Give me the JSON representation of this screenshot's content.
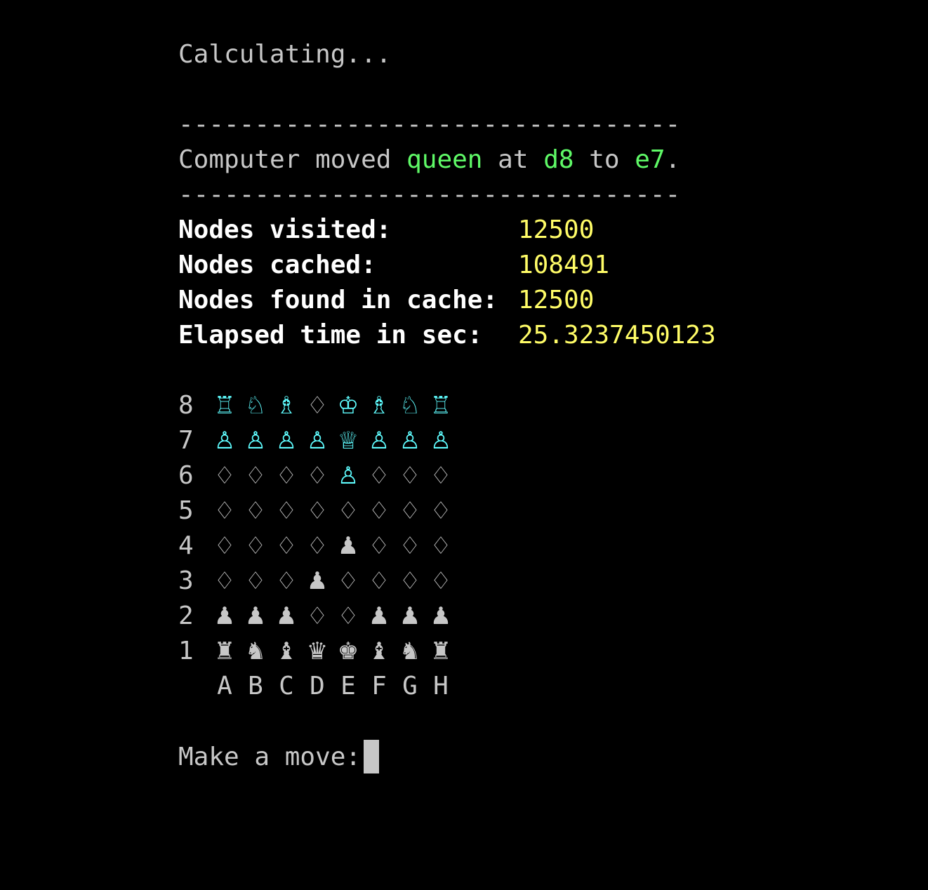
{
  "colors": {
    "background": "#000000",
    "text": "#c7c7c7",
    "bold_text": "#ffffff",
    "highlight_green": "#5ff967",
    "value_yellow": "#fffc67",
    "black_piece": "#5ffdff",
    "white_piece": "#c7c7c7"
  },
  "status": "Calculating...",
  "separator": "---------------------------------",
  "move_message": {
    "prefix": "Computer moved ",
    "piece": "queen",
    "at": " at ",
    "from": "d8",
    "to_word": " to ",
    "to": "e7",
    "suffix": "."
  },
  "stats": [
    {
      "label": "Nodes visited:",
      "value": "12500"
    },
    {
      "label": "Nodes cached:",
      "value": "108491"
    },
    {
      "label": "Nodes found in cache:",
      "value": "12500"
    },
    {
      "label": "Elapsed time in sec:",
      "value": "25.3237450123"
    }
  ],
  "board": {
    "ranks": [
      {
        "label": "8",
        "squares": [
          {
            "glyph": "♖",
            "side": "black"
          },
          {
            "glyph": "♘",
            "side": "black"
          },
          {
            "glyph": "♗",
            "side": "black"
          },
          {
            "glyph": "♢",
            "side": "empty"
          },
          {
            "glyph": "♔",
            "side": "black"
          },
          {
            "glyph": "♗",
            "side": "black"
          },
          {
            "glyph": "♘",
            "side": "black"
          },
          {
            "glyph": "♖",
            "side": "black"
          }
        ]
      },
      {
        "label": "7",
        "squares": [
          {
            "glyph": "♙",
            "side": "black"
          },
          {
            "glyph": "♙",
            "side": "black"
          },
          {
            "glyph": "♙",
            "side": "black"
          },
          {
            "glyph": "♙",
            "side": "black"
          },
          {
            "glyph": "♕",
            "side": "black"
          },
          {
            "glyph": "♙",
            "side": "black"
          },
          {
            "glyph": "♙",
            "side": "black"
          },
          {
            "glyph": "♙",
            "side": "black"
          }
        ]
      },
      {
        "label": "6",
        "squares": [
          {
            "glyph": "♢",
            "side": "empty"
          },
          {
            "glyph": "♢",
            "side": "empty"
          },
          {
            "glyph": "♢",
            "side": "empty"
          },
          {
            "glyph": "♢",
            "side": "empty"
          },
          {
            "glyph": "♙",
            "side": "black"
          },
          {
            "glyph": "♢",
            "side": "empty"
          },
          {
            "glyph": "♢",
            "side": "empty"
          },
          {
            "glyph": "♢",
            "side": "empty"
          }
        ]
      },
      {
        "label": "5",
        "squares": [
          {
            "glyph": "♢",
            "side": "empty"
          },
          {
            "glyph": "♢",
            "side": "empty"
          },
          {
            "glyph": "♢",
            "side": "empty"
          },
          {
            "glyph": "♢",
            "side": "empty"
          },
          {
            "glyph": "♢",
            "side": "empty"
          },
          {
            "glyph": "♢",
            "side": "empty"
          },
          {
            "glyph": "♢",
            "side": "empty"
          },
          {
            "glyph": "♢",
            "side": "empty"
          }
        ]
      },
      {
        "label": "4",
        "squares": [
          {
            "glyph": "♢",
            "side": "empty"
          },
          {
            "glyph": "♢",
            "side": "empty"
          },
          {
            "glyph": "♢",
            "side": "empty"
          },
          {
            "glyph": "♢",
            "side": "empty"
          },
          {
            "glyph": "♟",
            "side": "white"
          },
          {
            "glyph": "♢",
            "side": "empty"
          },
          {
            "glyph": "♢",
            "side": "empty"
          },
          {
            "glyph": "♢",
            "side": "empty"
          }
        ]
      },
      {
        "label": "3",
        "squares": [
          {
            "glyph": "♢",
            "side": "empty"
          },
          {
            "glyph": "♢",
            "side": "empty"
          },
          {
            "glyph": "♢",
            "side": "empty"
          },
          {
            "glyph": "♟",
            "side": "white"
          },
          {
            "glyph": "♢",
            "side": "empty"
          },
          {
            "glyph": "♢",
            "side": "empty"
          },
          {
            "glyph": "♢",
            "side": "empty"
          },
          {
            "glyph": "♢",
            "side": "empty"
          }
        ]
      },
      {
        "label": "2",
        "squares": [
          {
            "glyph": "♟",
            "side": "white"
          },
          {
            "glyph": "♟",
            "side": "white"
          },
          {
            "glyph": "♟",
            "side": "white"
          },
          {
            "glyph": "♢",
            "side": "empty"
          },
          {
            "glyph": "♢",
            "side": "empty"
          },
          {
            "glyph": "♟",
            "side": "white"
          },
          {
            "glyph": "♟",
            "side": "white"
          },
          {
            "glyph": "♟",
            "side": "white"
          }
        ]
      },
      {
        "label": "1",
        "squares": [
          {
            "glyph": "♜",
            "side": "white"
          },
          {
            "glyph": "♞",
            "side": "white"
          },
          {
            "glyph": "♝",
            "side": "white"
          },
          {
            "glyph": "♛",
            "side": "white"
          },
          {
            "glyph": "♚",
            "side": "white"
          },
          {
            "glyph": "♝",
            "side": "white"
          },
          {
            "glyph": "♞",
            "side": "white"
          },
          {
            "glyph": "♜",
            "side": "white"
          }
        ]
      }
    ],
    "files": [
      "A",
      "B",
      "C",
      "D",
      "E",
      "F",
      "G",
      "H"
    ]
  },
  "prompt": "Make a move:",
  "input_value": ""
}
